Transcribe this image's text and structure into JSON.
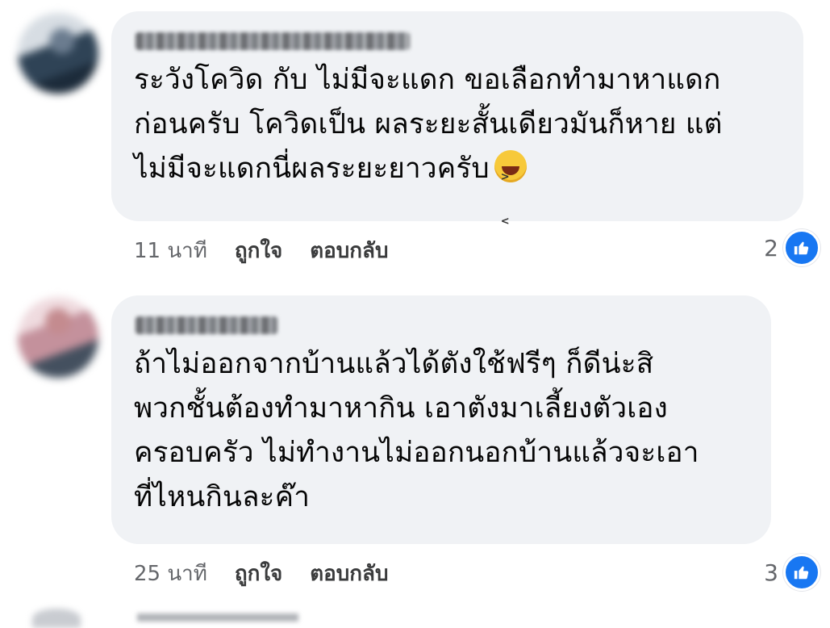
{
  "comments": [
    {
      "author": "",
      "text": "ระวังโควิด กับ ไม่มีจะแดก ขอเลือกทำมาหาแดก\nก่อนครับ โควิดเป็น ผลระยะสั้นเดียวมันก็หาย แต่\nไม่มีจะแดกนี่ผลระยะยาวครับ",
      "emoji": "laughing-face-emoji",
      "time": "11 นาที",
      "like_label": "ถูกใจ",
      "reply_label": "ตอบกลับ",
      "reaction_count": "2",
      "reaction_icon": "like-icon"
    },
    {
      "author": "",
      "text": "ถ้าไม่ออกจากบ้านแล้วได้ตังใช้ฟรีๆ ก็ดีน่ะสิ\nพวกชั้นต้องทำมาหากิน เอาตังมาเลี้ยงตัวเอง\nครอบครัว ไม่ทำงานไม่ออกนอกบ้านแล้วจะเอา\nที่ไหนกินละค๊า",
      "time": "25 นาที",
      "like_label": "ถูกใจ",
      "reply_label": "ตอบกลับ",
      "reaction_count": "3",
      "reaction_icon": "like-icon"
    }
  ],
  "colors": {
    "bubble": "#f0f2f5",
    "meta_text": "#65676b",
    "like_blue": "#1877f2"
  }
}
